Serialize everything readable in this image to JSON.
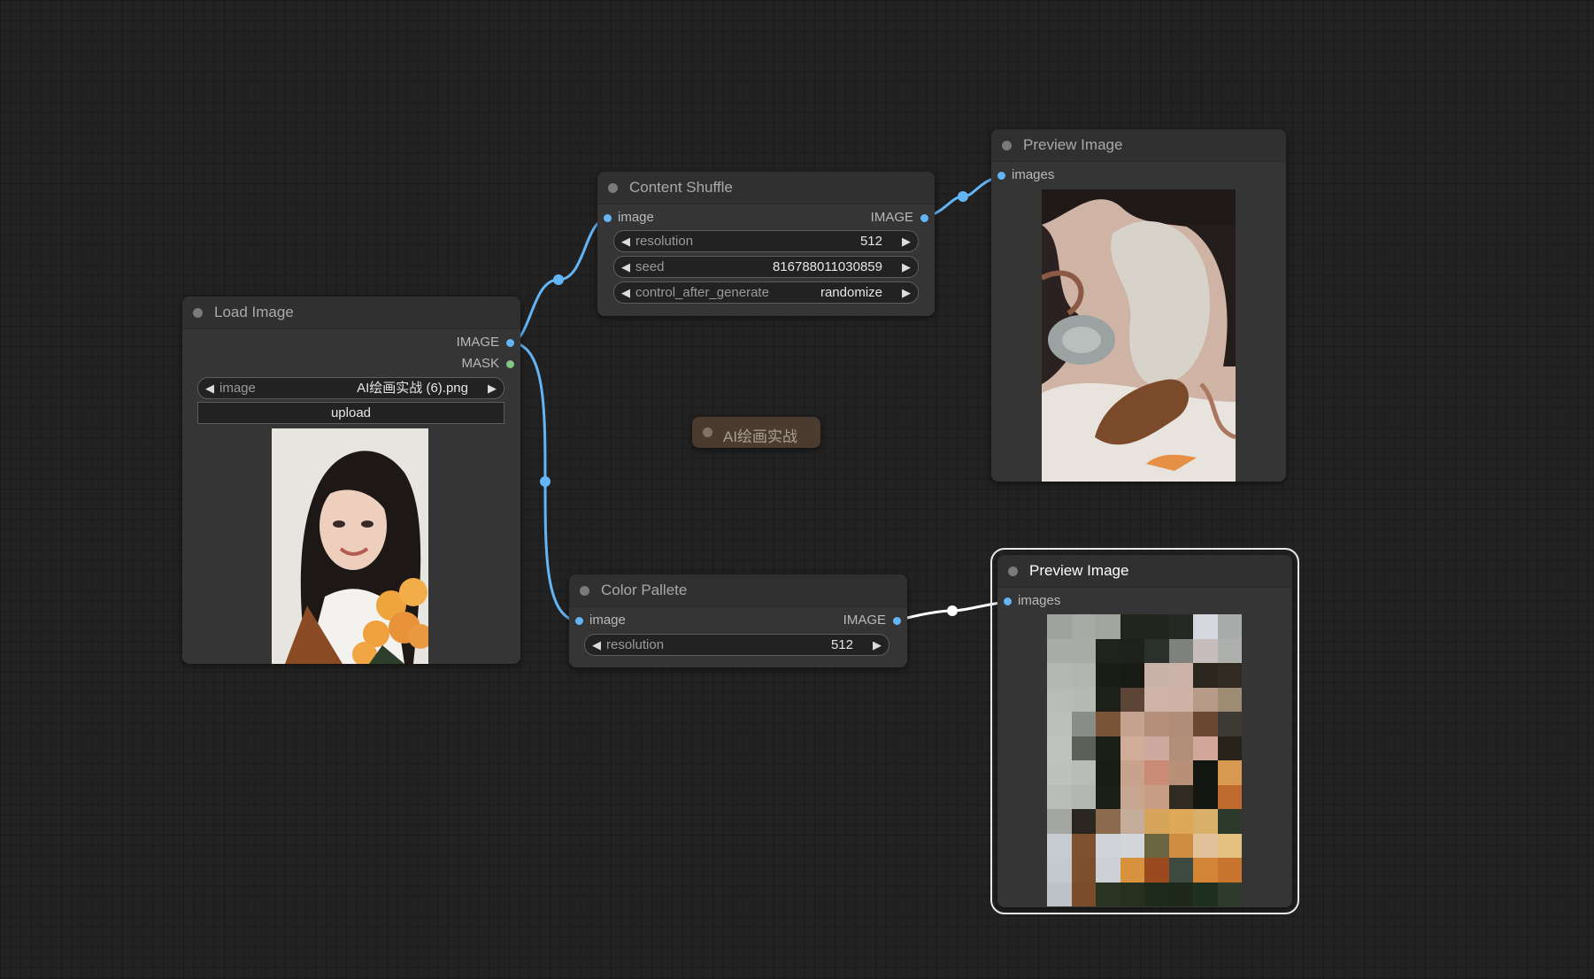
{
  "colors": {
    "canvas": "#222222",
    "node_body": "#353535",
    "image_link": "#64b5f6",
    "mask_slot": "#81c784",
    "selected_link": "#ffffff",
    "note_bg": "#4b3a2e"
  },
  "load_image": {
    "title": "Load Image",
    "outputs": [
      "IMAGE",
      "MASK"
    ],
    "widget_image_label": "image",
    "widget_image_value": "AI绘画实战 (6).png",
    "upload_label": "upload",
    "preview_icon": "portrait-photo"
  },
  "content_shuffle": {
    "title": "Content Shuffle",
    "input_label": "image",
    "output_label": "IMAGE",
    "resolution_label": "resolution",
    "resolution_value": "512",
    "seed_label": "seed",
    "seed_value": "816788011030859",
    "control_label": "control_after_generate",
    "control_value": "randomize"
  },
  "color_pallete": {
    "title": "Color Pallete",
    "input_label": "image",
    "output_label": "IMAGE",
    "resolution_label": "resolution",
    "resolution_value": "512"
  },
  "preview_top": {
    "title": "Preview Image",
    "input_label": "images",
    "preview_icon": "shuffled-image"
  },
  "preview_bottom": {
    "title": "Preview Image",
    "input_label": "images",
    "preview_icon": "color-palette-grid",
    "palette": [
      [
        "#9ea39e",
        "#a6aba6",
        "#a0a59e",
        "#22241e",
        "#23251f",
        "#262823",
        "#d6d7de",
        "#a8acaa"
      ],
      [
        "#a9ada9",
        "#a7aca7",
        "#20221c",
        "#1e211c",
        "#2a302b",
        "#7e817c",
        "#c7bdbc",
        "#adb0ad"
      ],
      [
        "#b5b7b3",
        "#b3b5b1",
        "#1b1d17",
        "#181a14",
        "#c9b2aa",
        "#cdb2a9",
        "#2a261e",
        "#302a20"
      ],
      [
        "#b9bbb6",
        "#b7b9b4",
        "#1d1f19",
        "#5c4537",
        "#d0b3a7",
        "#cfb1a5",
        "#b89a88",
        "#9d8b74"
      ],
      [
        "#bdbfbb",
        "#8a8e88",
        "#7a5538",
        "#c4a28f",
        "#b58f7a",
        "#b08d78",
        "#6a4832",
        "#3c3a32"
      ],
      [
        "#c0c2be",
        "#5b6058",
        "#1c1e18",
        "#d1ad99",
        "#cfa9a0",
        "#b28f79",
        "#d0a799",
        "#272319"
      ],
      [
        "#bfc1bd",
        "#babcb8",
        "#1a1c16",
        "#c8a28d",
        "#c98b76",
        "#b89078",
        "#141711",
        "#d6994f"
      ],
      [
        "#babcb8",
        "#b4b6b2",
        "#1c1e18",
        "#c7a590",
        "#c79d83",
        "#2f2a22",
        "#141711",
        "#c0692e"
      ],
      [
        "#a4a6a2",
        "#2b2720",
        "#8b6a50",
        "#c4ad9a",
        "#d7a45c",
        "#dfa859",
        "#d9b069",
        "#2c3a2c"
      ],
      [
        "#c7ccd1",
        "#7e512f",
        "#d0d4d9",
        "#d3d6d9",
        "#6b6440",
        "#cf8d42",
        "#e1c19a",
        "#e5c17f"
      ],
      [
        "#c4c9ce",
        "#7c4f2d",
        "#cdd1d6",
        "#d8913c",
        "#9a4a1e",
        "#3d4a3f",
        "#d18535",
        "#c7742f"
      ],
      [
        "#bdc2c6",
        "#7a4c2a",
        "#283322",
        "#25301f",
        "#1e2a1c",
        "#1d281a",
        "#203020",
        "#2e3d2b"
      ]
    ]
  },
  "note": {
    "label": "AI绘画实战"
  }
}
